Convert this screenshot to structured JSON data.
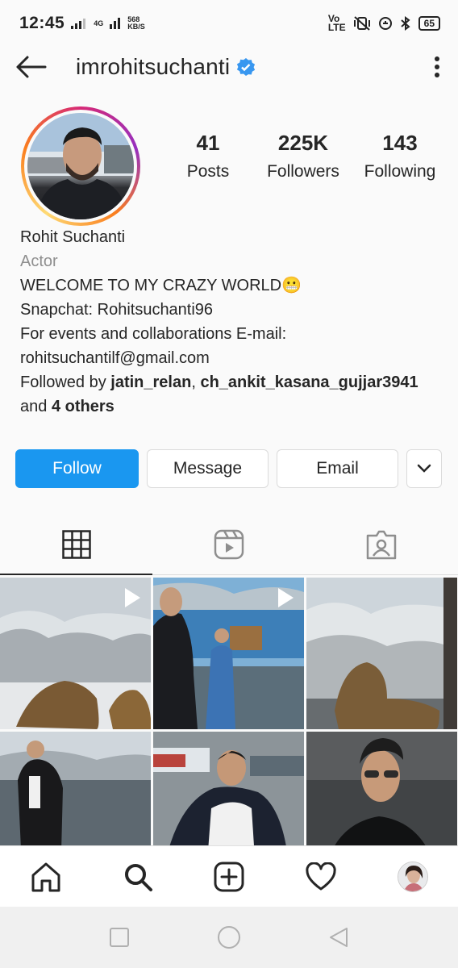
{
  "status_bar": {
    "time": "12:45",
    "network_type": "4G",
    "speed_value": "568",
    "speed_unit": "KB/S",
    "volte_top": "Vo",
    "volte_bottom": "LTE",
    "battery": "65"
  },
  "header": {
    "username": "imrohitsuchanti"
  },
  "stats": [
    {
      "value": "41",
      "label": "Posts"
    },
    {
      "value": "225K",
      "label": "Followers"
    },
    {
      "value": "143",
      "label": "Following"
    }
  ],
  "bio": {
    "name": "Rohit Suchanti",
    "category": "Actor",
    "line1": "WELCOME TO MY CRAZY WORLD",
    "line1_emoji": "😬",
    "line2": "Snapchat: Rohitsuchanti96",
    "line3": "For events and collaborations E-mail:",
    "line4": "rohitsuchantilf@gmail.com",
    "followed_prefix": "Followed by ",
    "followed_user1": "jatin_relan",
    "followed_sep": ", ",
    "followed_user2": "ch_ankit_kasana_gujjar3941",
    "followed_and": "and ",
    "followed_others": "4 others"
  },
  "buttons": {
    "follow": "Follow",
    "message": "Message",
    "email": "Email"
  },
  "colors": {
    "accent": "#1a97f0",
    "verified": "#3897f0"
  }
}
